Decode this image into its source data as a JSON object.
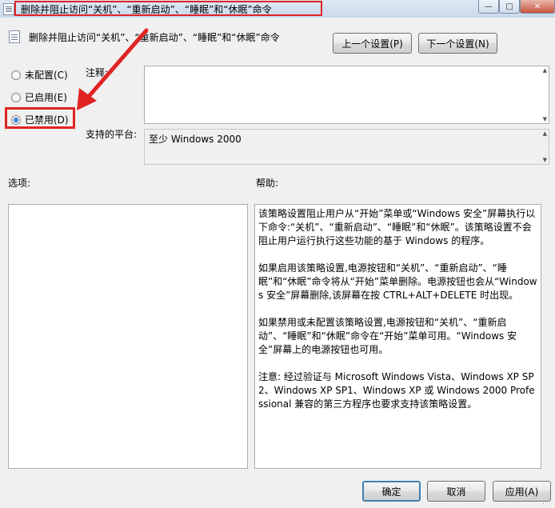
{
  "window": {
    "title": "删除并阻止访问“关机”、“重新启动”、“睡眠”和“休眠”命令",
    "controls": {
      "minimize": "—",
      "maximize": "□",
      "close": "✕"
    }
  },
  "header": {
    "policy_name": "删除并阻止访问“关机”、“重新启动”、“睡眠”和“休眠”命令",
    "prev_setting": "上一个设置(P)",
    "next_setting": "下一个设置(N)"
  },
  "state_options": [
    {
      "label": "未配置(C)",
      "checked": false
    },
    {
      "label": "已启用(E)",
      "checked": false
    },
    {
      "label": "已禁用(D)",
      "checked": true
    }
  ],
  "comment": {
    "label": "注释:",
    "value": ""
  },
  "platform": {
    "label": "支持的平台:",
    "value": "至少 Windows 2000"
  },
  "options": {
    "label": "选项:"
  },
  "help": {
    "label": "帮助:",
    "paragraphs": [
      "该策略设置阻止用户从“开始”菜单或“Windows 安全”屏幕执行以下命令:“关机”、“重新启动”、“睡眠”和“休眠”。该策略设置不会阻止用户运行执行这些功能的基于 Windows 的程序。",
      "如果启用该策略设置,电源按钮和“关机”、“重新启动”、“睡眠”和“休眠”命令将从“开始”菜单删除。电源按钮也会从“Windows 安全”屏幕删除,该屏幕在按 CTRL+ALT+DELETE 时出现。",
      "如果禁用或未配置该策略设置,电源按钮和“关机”、“重新启动”、“睡眠”和“休眠”命令在“开始”菜单可用。“Windows 安全”屏幕上的电源按钮也可用。",
      "注意: 经过验证与 Microsoft Windows Vista、Windows XP SP2、Windows XP SP1、Windows XP 或 Windows 2000 Professional 兼容的第三方程序也要求支持该策略设置。"
    ]
  },
  "footer": {
    "ok": "确定",
    "cancel": "取消",
    "apply": "应用(A)"
  },
  "colors": {
    "annotation": "#e02424",
    "background": "#f0f0f0"
  },
  "icons": {
    "window": "policy-document-icon",
    "policy": "policy-document-icon"
  }
}
